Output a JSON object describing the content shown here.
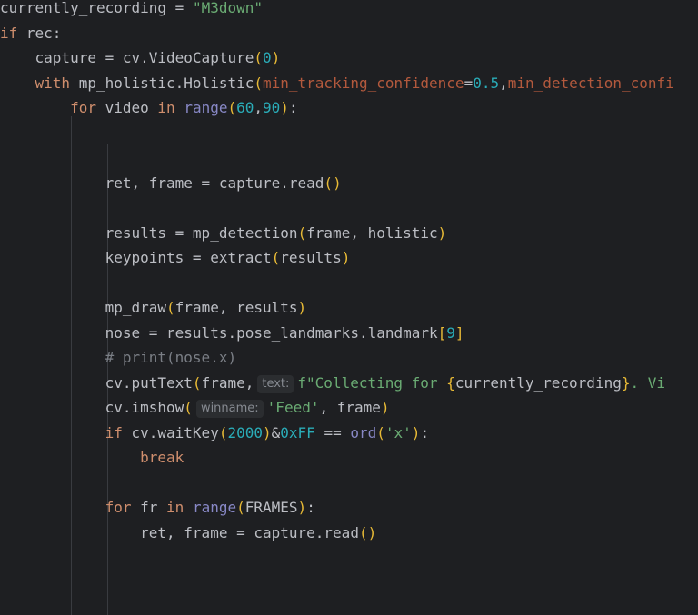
{
  "code": {
    "l1": {
      "var": "currently_recording",
      "op": " = ",
      "str": "\"M3down\""
    },
    "l2": {
      "kw": "if",
      "rest": " rec:"
    },
    "l3": {
      "indent": "    ",
      "lhs": "capture = cv.VideoCapture",
      "lp": "(",
      "num": "0",
      "rp": ")"
    },
    "l4": {
      "indent": "    ",
      "kw": "with",
      "mid": " mp_holistic.Holistic",
      "lp": "(",
      "p1": "min_tracking_confidence",
      "eq1": "=",
      "v1": "0.5",
      "comma": ",",
      "p2": "min_detection_confi"
    },
    "l5": {
      "indent": "        ",
      "kw1": "for",
      "a": " video ",
      "kw2": "in",
      "sp": " ",
      "bi": "range",
      "lp": "(",
      "n1": "60",
      "c": ",",
      "n2": "90",
      "rp": ")",
      "colon": ":"
    },
    "l6": {
      "indent": "            ",
      "lhs": "ret, frame = capture.read",
      "lp": "(",
      "rp": ")"
    },
    "l7": {
      "indent": "            ",
      "lhs": "results = mp_detection",
      "lp": "(",
      "args": "frame, holistic",
      "rp": ")"
    },
    "l8": {
      "indent": "            ",
      "lhs": "keypoints = extract",
      "lp": "(",
      "args": "results",
      "rp": ")"
    },
    "l9": {
      "indent": "            ",
      "lhs": "mp_draw",
      "lp": "(",
      "args": "frame, results",
      "rp": ")"
    },
    "l10": {
      "indent": "            ",
      "lhs": "nose = results.pose_landmarks.landmark",
      "lb": "[",
      "num": "9",
      "rb": "]"
    },
    "l11": {
      "indent": "            ",
      "cmt": "# print(nose.x)"
    },
    "l12": {
      "indent": "            ",
      "lhs": "cv.putText",
      "lp": "(",
      "a": "frame,",
      "hint": "text:",
      "fpre": "f\"Collecting for ",
      "lc": "{",
      "var": "currently_recording",
      "rc": "}",
      "tail": ". Vi"
    },
    "l13": {
      "indent": "            ",
      "lhs": "cv.imshow",
      "lp": "(",
      "hint": "winname:",
      "str": "'Feed'",
      "rest": ", frame",
      "rp": ")"
    },
    "l14": {
      "indent": "            ",
      "kw": "if",
      "a": " cv.waitKey",
      "lp": "(",
      "n1": "2000",
      "rp": ")",
      "b": "&",
      "n2": "0xFF",
      "c": " == ",
      "bi": "ord",
      "lp2": "(",
      "str": "'x'",
      "rp2": ")",
      "colon": ":"
    },
    "l15": {
      "indent": "                ",
      "kw": "break"
    },
    "l16": {
      "indent": "            ",
      "kw1": "for",
      "a": " fr ",
      "kw2": "in",
      "sp": " ",
      "bi": "range",
      "lp": "(",
      "arg": "FRAMES",
      "rp": ")",
      "colon": ":"
    },
    "l17": {
      "indent": "                ",
      "lhs": "ret, frame = capture.read",
      "lp": "(",
      "rp": ")"
    }
  }
}
